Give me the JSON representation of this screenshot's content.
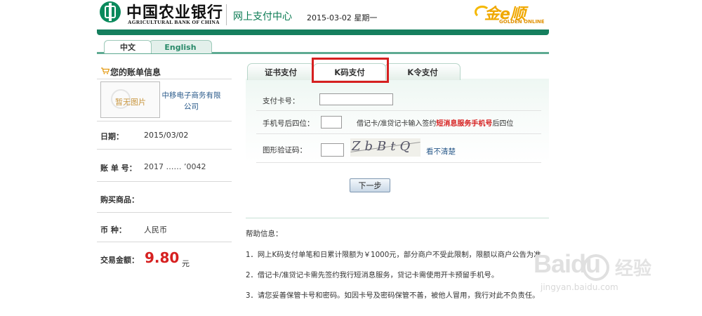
{
  "header": {
    "bank_name_cn": "中国农业银行",
    "bank_name_en": "AGRICULTURAL BANK OF CHINA",
    "site_title": "网上支付中心",
    "date": "2015-03-02 星期一",
    "partner_logo_cn": "金e顺",
    "partner_logo_en": "GOLDEN ONLINE"
  },
  "language_tabs": [
    {
      "label": "中文",
      "active": true
    },
    {
      "label": "English",
      "active": false
    }
  ],
  "bill": {
    "title": "您的账单信息",
    "merchant_image_placeholder": "暂无图片",
    "merchant_name": "中移电子商务有限公司",
    "date_label": "日期：",
    "date_value": "2015/03/02",
    "bill_no_label": "账 单 号：",
    "bill_no_value": "2017  ……  ’0042",
    "goods_label": "购买商品：",
    "currency_label": "币 种：",
    "currency_value": "人民币",
    "amount_label": "交易金额：",
    "amount_value": "9.80",
    "amount_unit": "元"
  },
  "payment_tabs": [
    {
      "label": "证书支付",
      "active": false
    },
    {
      "label": "K码支付",
      "active": true
    },
    {
      "label": "K令支付",
      "active": false
    }
  ],
  "form": {
    "card_label": "支付卡号：",
    "card_value": "",
    "phone_label": "手机号后四位：",
    "phone_value": "",
    "phone_hint_prefix": "借记卡/准贷记卡输入签约",
    "phone_hint_highlight": "短消息服务手机号",
    "phone_hint_suffix": "后四位",
    "captcha_label": "图形验证码：",
    "captcha_value": "",
    "captcha_text": "ZbBtQ",
    "captcha_refresh": "看不清楚",
    "next_button": "下一步"
  },
  "help": {
    "title": "帮助信息：",
    "items": [
      "1．网上K码支付单笔和日累计限额为￥1000元，部分商户不受此限制，限额以商户公告为准。",
      "2．借记卡/准贷记卡需先签约我行短消息服务，贷记卡需使用开卡预留手机号。",
      "3．请您妥善保管卡号和密码。如因卡号及密码保管不善，被他人冒用，我行对此不负责任。"
    ]
  },
  "watermark": {
    "logo": "Baidu",
    "logo_cn": "经验",
    "url": "jingyan.baidu.com"
  },
  "colors": {
    "brand_green": "#157f5e",
    "highlight_red": "#d62020",
    "amount_red": "#d62020"
  }
}
